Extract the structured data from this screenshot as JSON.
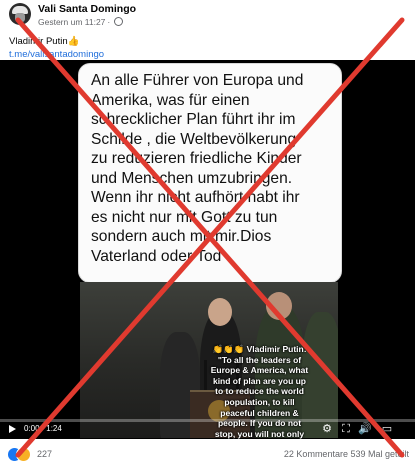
{
  "post": {
    "author": "Vali Santa Domingo",
    "timestamp": "Gestern um 11:27",
    "caption_line1": "Vladimir Putin👍",
    "caption_link": "t.me/valisantadomingo"
  },
  "video": {
    "card_text": "An alle Führer von Europa und\nAmerika, was für einen\nschrecklicher Plan führt ihr im\nSchilde , die Weltbevölkerung\nzu reduzieren friedliche Kinder\nund  Menschen umzubringen.\nWenn ihr nicht aufhört habt ihr\nes nicht nur mit Gott zu tun\nsondern auch mit mir.Dios\nVaterland oder Tod",
    "overlay_emoji": "👏👏👏",
    "overlay_text": " Vladimir Putin:\n\"To all the leaders of\nEurope & America, what\nkind of plan are you up\nto to reduce the world\npopulation, to kill\npeaceful children &\npeople. If you do not\nstop, you will not only\nhave to deal with God,\nbut also with me. Dios\nfatherland or death\"",
    "time": "0:00 / 1:24",
    "progress": 0.0
  },
  "footer": {
    "reactions_count": "227",
    "stats": "22 Kommentare  539 Mal geteilt"
  },
  "icons": {
    "play": "play-icon",
    "settings": "gear-icon",
    "fullscreen": "fullscreen-icon",
    "volume": "volume-icon",
    "mini_player": "mini-player-icon"
  },
  "colors": {
    "x_mark": "#e03a2f",
    "link": "#216fdb",
    "like": "#1877f2"
  }
}
